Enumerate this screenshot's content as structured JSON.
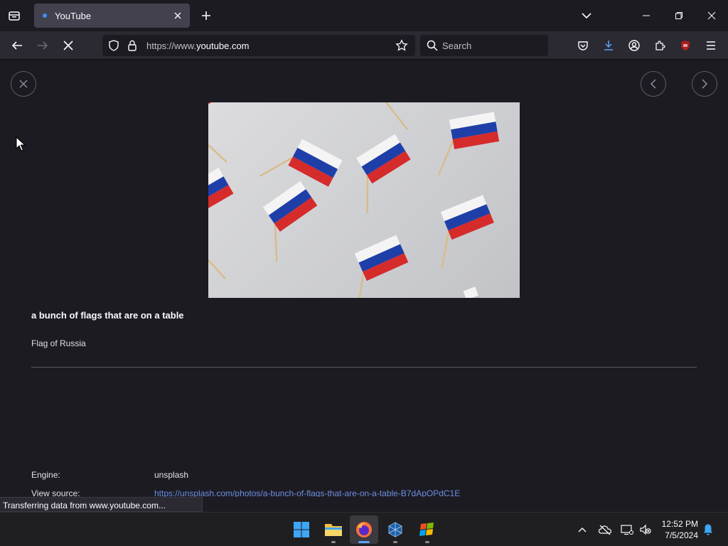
{
  "browser": {
    "tab": {
      "title": "YouTube"
    },
    "url": {
      "prefix": "https://www.",
      "host": "youtube.com",
      "suffix": ""
    },
    "search": {
      "placeholder": "Search"
    }
  },
  "viewer": {
    "caption_title": "a bunch of flags that are on a table",
    "caption_subtitle": "Flag of Russia",
    "meta": [
      {
        "label": "Engine:",
        "value": "unsplash"
      },
      {
        "label": "View source:",
        "value": "https://unsplash.com/photos/a-bunch-of-flags-that-are-on-a-table-B7dApOPdC1E"
      }
    ]
  },
  "status": {
    "text": "Transferring data from www.youtube.com..."
  },
  "taskbar": {
    "time": "12:52 PM",
    "date": "7/5/2024"
  },
  "colors": {
    "flag_white": "#f4f4f4",
    "flag_blue": "#1f3fa8",
    "flag_red": "#d52b2b",
    "link": "#6c8fe0",
    "accent": "#5ba3f5"
  }
}
